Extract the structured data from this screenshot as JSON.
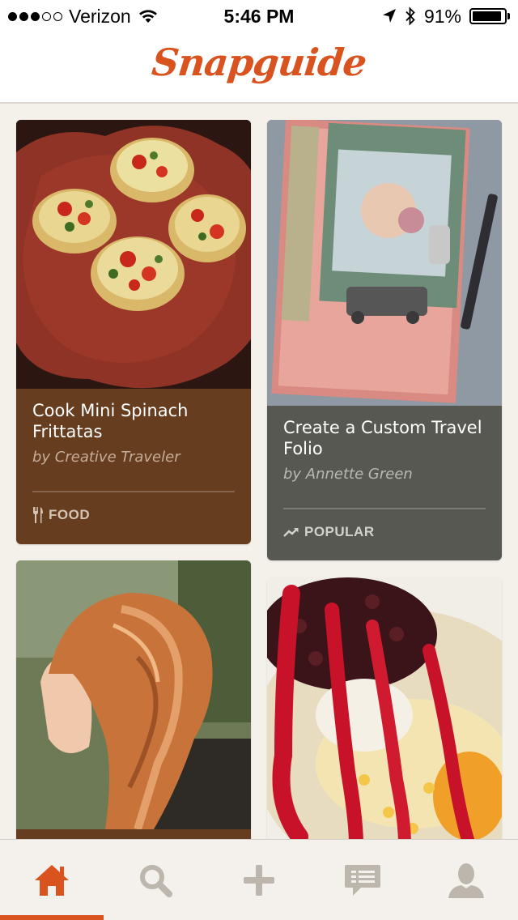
{
  "status_bar": {
    "carrier": "Verizon",
    "time": "5:46 PM",
    "battery_percent": "91%",
    "battery_level": 0.91,
    "signal_bars_filled": 3,
    "signal_bars_total": 5,
    "icons": [
      "wifi-icon",
      "location-arrow-icon",
      "bluetooth-icon",
      "battery-icon"
    ]
  },
  "header": {
    "logo_text": "Snapguide",
    "brand_color": "#d9531e"
  },
  "cards": [
    {
      "title": "Cook Mini Spinach Frittatas",
      "author": "by Creative Traveler",
      "tag": "FOOD",
      "tag_icon": "fork-knife-icon",
      "color": "#673d1f"
    },
    {
      "title": "Create a Custom Travel Folio",
      "author": "by Annette Green",
      "tag": "POPULAR",
      "tag_icon": "trending-up-icon",
      "color": "#585853"
    },
    {
      "color": "#673d1f"
    },
    {
      "color": "#ffffff"
    }
  ],
  "tab_bar": {
    "active_index": 0,
    "active_color": "#d9531e",
    "inactive_color": "#bdb6ad",
    "tabs": [
      {
        "icon": "home-icon"
      },
      {
        "icon": "search-icon"
      },
      {
        "icon": "plus-icon"
      },
      {
        "icon": "messages-icon"
      },
      {
        "icon": "profile-icon"
      }
    ]
  }
}
